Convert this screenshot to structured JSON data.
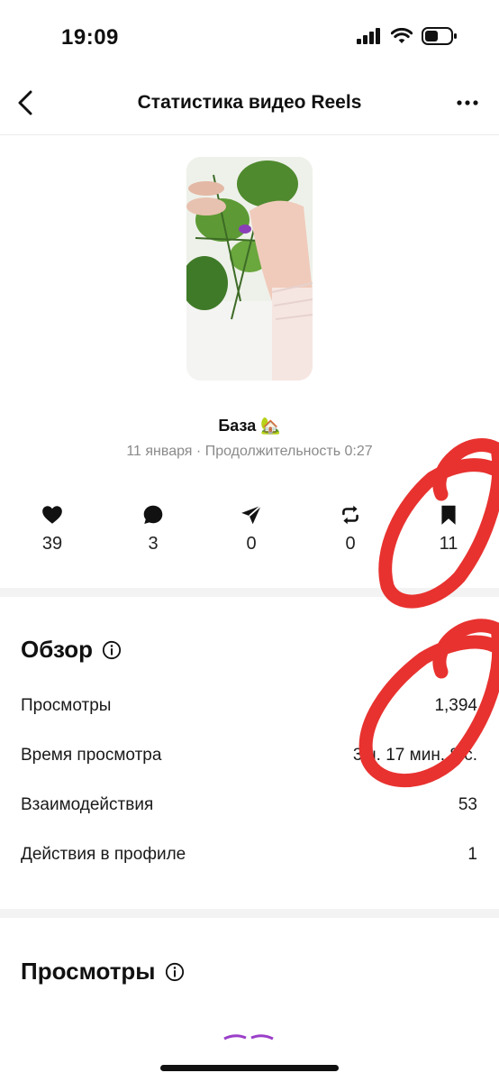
{
  "status_bar": {
    "time": "19:09"
  },
  "nav": {
    "title": "Статистика видео Reels"
  },
  "reel": {
    "title": "База",
    "title_emoji": "🏡",
    "meta": "11 января · Продолжительность 0:27"
  },
  "stats": [
    {
      "icon": "heart-icon",
      "value": "39"
    },
    {
      "icon": "comment-icon",
      "value": "3"
    },
    {
      "icon": "share-icon",
      "value": "0"
    },
    {
      "icon": "repost-icon",
      "value": "0"
    },
    {
      "icon": "bookmark-icon",
      "value": "11"
    }
  ],
  "overview": {
    "title": "Обзор",
    "rows": [
      {
        "label": "Просмотры",
        "value": "1,394"
      },
      {
        "label": "Время просмотра",
        "value": "3 ч. 17 мин. 8 с."
      },
      {
        "label": "Взаимодействия",
        "value": "53"
      },
      {
        "label": "Действия в профиле",
        "value": "1"
      }
    ]
  },
  "views_section": {
    "title": "Просмотры"
  },
  "colors": {
    "annotation_red": "#e8322f",
    "divider": "#f3f3f3",
    "muted_text": "#8a8a8a"
  }
}
